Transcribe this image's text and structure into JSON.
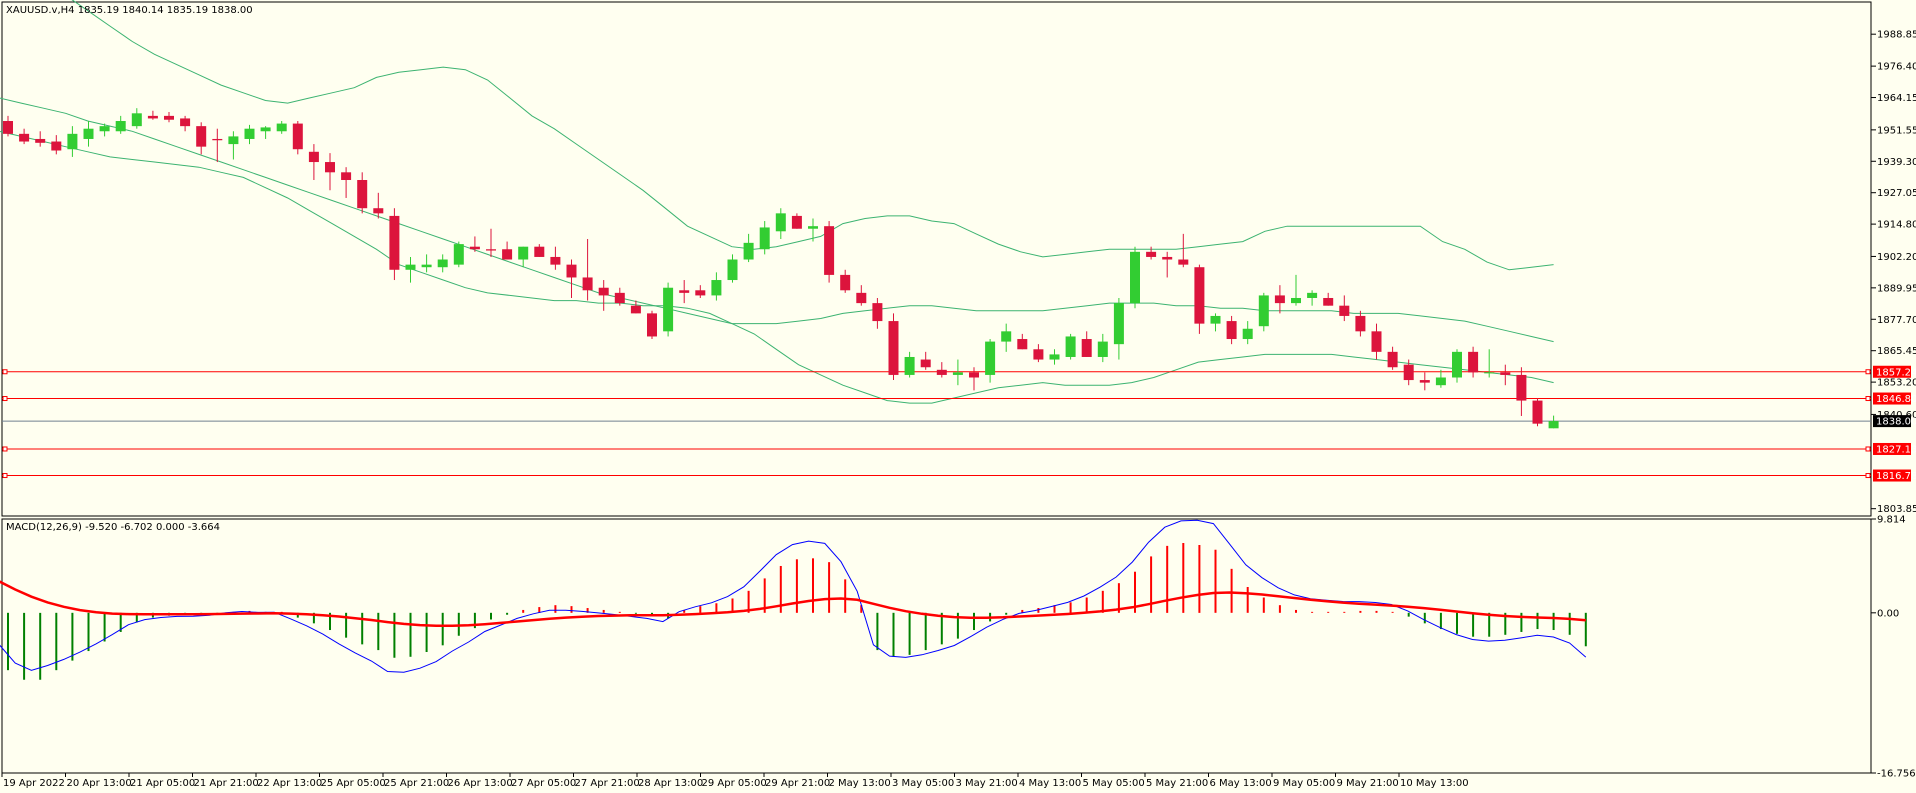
{
  "symbol_label": "XAUUSD.v,H4  1835.19 1840.14 1835.19 1838.00",
  "macd_label": "MACD(12,26,9) -9.520 -6.702 0.000 -3.664",
  "colors": {
    "background": "#fffff0",
    "bull": "#32cd32",
    "bear": "#dc143c",
    "band": "#3cb371",
    "level_line": "#ff0000",
    "current_line": "#708090",
    "macd_line": "#0000ff",
    "signal_line": "#ff0000",
    "hist_pos": "#ff0000",
    "hist_neg": "#008000"
  },
  "chart_data": [
    {
      "type": "candlestick",
      "title": "XAUUSD.v,H4",
      "ylim": [
        1801.0,
        2001.4
      ],
      "y_ticks": [
        1988.85,
        1976.4,
        1964.15,
        1951.55,
        1939.3,
        1927.05,
        1914.8,
        1902.2,
        1889.95,
        1877.7,
        1865.45,
        1853.2,
        1840.6,
        1803.85
      ],
      "x_ticks": [
        "19 Apr 2022",
        "20 Apr 13:00",
        "21 Apr 05:00",
        "21 Apr 21:00",
        "22 Apr 13:00",
        "25 Apr 05:00",
        "25 Apr 21:00",
        "26 Apr 13:00",
        "27 Apr 05:00",
        "27 Apr 21:00",
        "28 Apr 13:00",
        "29 Apr 05:00",
        "29 Apr 21:00",
        "2 May 13:00",
        "3 May 05:00",
        "3 May 21:00",
        "4 May 13:00",
        "5 May 05:00",
        "5 May 21:00",
        "6 May 13:00",
        "9 May 05:00",
        "9 May 21:00",
        "10 May 13:00"
      ],
      "candles": [
        [
          1955.0,
          1957.0,
          1949.0,
          1950.0
        ],
        [
          1950.0,
          1952.0,
          1946.0,
          1947.0
        ],
        [
          1948.0,
          1951.0,
          1945.0,
          1946.5
        ],
        [
          1947.0,
          1949.5,
          1942.0,
          1943.5
        ],
        [
          1944.0,
          1953.0,
          1941.0,
          1950.0
        ],
        [
          1948.0,
          1955.0,
          1945.0,
          1952.0
        ],
        [
          1951.0,
          1954.0,
          1949.0,
          1953.0
        ],
        [
          1951.0,
          1957.0,
          1950.0,
          1955.0
        ],
        [
          1953.0,
          1960.0,
          1952.0,
          1958.0
        ],
        [
          1957.0,
          1959.0,
          1955.5,
          1956.0
        ],
        [
          1957.0,
          1958.5,
          1954.5,
          1955.5
        ],
        [
          1956.0,
          1957.0,
          1951.0,
          1953.0
        ],
        [
          1953.0,
          1954.5,
          1942.0,
          1945.0
        ],
        [
          1948.0,
          1952.0,
          1939.0,
          1947.5
        ],
        [
          1946.0,
          1951.0,
          1940.0,
          1949.0
        ],
        [
          1948.0,
          1953.5,
          1946.0,
          1952.0
        ],
        [
          1951.0,
          1953.0,
          1948.0,
          1952.5
        ],
        [
          1951.0,
          1955.0,
          1950.0,
          1954.0
        ],
        [
          1954.0,
          1955.0,
          1942.0,
          1944.0
        ],
        [
          1943.0,
          1946.0,
          1932.0,
          1939.0
        ],
        [
          1939.0,
          1942.5,
          1928.0,
          1935.0
        ],
        [
          1935.0,
          1937.0,
          1925.0,
          1932.0
        ],
        [
          1932.0,
          1935.0,
          1919.0,
          1921.0
        ],
        [
          1921.0,
          1927.0,
          1917.0,
          1919.0
        ],
        [
          1918.0,
          1921.0,
          1893.0,
          1897.0
        ],
        [
          1897.0,
          1902.0,
          1892.0,
          1899.0
        ],
        [
          1898.0,
          1903.0,
          1896.0,
          1899.0
        ],
        [
          1898.0,
          1903.0,
          1896.0,
          1901.0
        ],
        [
          1899.0,
          1908.0,
          1898.0,
          1907.0
        ],
        [
          1906.0,
          1910.0,
          1904.0,
          1905.0
        ],
        [
          1905.0,
          1913.0,
          1902.0,
          1904.5
        ],
        [
          1905.0,
          1908.0,
          1901.0,
          1901.0
        ],
        [
          1901.0,
          1906.0,
          1898.0,
          1906.0
        ],
        [
          1906.0,
          1907.0,
          1902.0,
          1902.0
        ],
        [
          1902.0,
          1906.0,
          1897.0,
          1899.0
        ],
        [
          1899.0,
          1901.0,
          1886.0,
          1894.0
        ],
        [
          1894.0,
          1909.0,
          1885.0,
          1889.0
        ],
        [
          1890.0,
          1893.0,
          1881.0,
          1887.0
        ],
        [
          1888.0,
          1890.0,
          1883.0,
          1884.0
        ],
        [
          1883.0,
          1885.0,
          1880.0,
          1880.0
        ],
        [
          1880.0,
          1881.0,
          1870.0,
          1871.0
        ],
        [
          1873.0,
          1892.0,
          1871.0,
          1890.0
        ],
        [
          1889.0,
          1893.0,
          1884.0,
          1888.0
        ],
        [
          1889.0,
          1891.0,
          1886.0,
          1887.0
        ],
        [
          1887.0,
          1896.0,
          1885.0,
          1893.0
        ],
        [
          1893.0,
          1903.0,
          1892.0,
          1901.0
        ],
        [
          1901.0,
          1911.0,
          1900.0,
          1907.5
        ],
        [
          1905.0,
          1916.0,
          1903.0,
          1913.5
        ],
        [
          1912.0,
          1921.0,
          1909.0,
          1919.0
        ],
        [
          1918.0,
          1919.0,
          1913.0,
          1913.0
        ],
        [
          1913.0,
          1917.0,
          1908.0,
          1914.0
        ],
        [
          1914.0,
          1916.0,
          1892.0,
          1895.0
        ],
        [
          1895.0,
          1897.0,
          1888.0,
          1889.0
        ],
        [
          1888.0,
          1891.0,
          1883.0,
          1884.0
        ],
        [
          1884.0,
          1886.0,
          1874.0,
          1877.0
        ],
        [
          1877.0,
          1880.0,
          1854.0,
          1856.0
        ],
        [
          1856.0,
          1865.0,
          1855.0,
          1863.0
        ],
        [
          1862.0,
          1865.0,
          1858.0,
          1859.0
        ],
        [
          1858.0,
          1861.0,
          1855.0,
          1856.0
        ],
        [
          1856.0,
          1862.0,
          1852.0,
          1857.0
        ],
        [
          1857.0,
          1859.0,
          1850.0,
          1855.0
        ],
        [
          1856.0,
          1870.0,
          1853.0,
          1869.0
        ],
        [
          1869.0,
          1876.0,
          1865.0,
          1873.0
        ],
        [
          1870.0,
          1872.0,
          1866.0,
          1866.0
        ],
        [
          1866.0,
          1868.0,
          1861.0,
          1862.0
        ],
        [
          1862.0,
          1866.0,
          1860.0,
          1864.0
        ],
        [
          1863.0,
          1872.0,
          1862.0,
          1871.0
        ],
        [
          1870.0,
          1873.0,
          1863.0,
          1863.0
        ],
        [
          1863.0,
          1872.0,
          1861.0,
          1869.0
        ],
        [
          1868.0,
          1886.0,
          1862.0,
          1884.0
        ],
        [
          1884.0,
          1906.0,
          1882.0,
          1904.0
        ],
        [
          1904.0,
          1906.0,
          1901.0,
          1902.0
        ],
        [
          1902.0,
          1904.0,
          1894.0,
          1901.0
        ],
        [
          1901.0,
          1911.0,
          1898.0,
          1899.0
        ],
        [
          1898.0,
          1899.0,
          1872.0,
          1876.0
        ],
        [
          1876.0,
          1880.0,
          1873.0,
          1879.0
        ],
        [
          1877.0,
          1879.0,
          1868.0,
          1870.0
        ],
        [
          1870.0,
          1877.0,
          1868.0,
          1874.0
        ],
        [
          1875.0,
          1888.0,
          1873.0,
          1887.0
        ],
        [
          1887.0,
          1891.0,
          1880.0,
          1884.0
        ],
        [
          1884.0,
          1895.0,
          1883.0,
          1886.0
        ],
        [
          1886.0,
          1889.0,
          1883.0,
          1888.0
        ],
        [
          1886.0,
          1888.0,
          1883.0,
          1883.0
        ],
        [
          1883.0,
          1887.0,
          1877.0,
          1879.0
        ],
        [
          1879.0,
          1881.0,
          1871.0,
          1873.0
        ],
        [
          1873.0,
          1876.0,
          1862.0,
          1865.0
        ],
        [
          1865.0,
          1867.0,
          1858.0,
          1859.0
        ],
        [
          1860.0,
          1862.0,
          1852.0,
          1854.0
        ],
        [
          1854.0,
          1857.0,
          1850.0,
          1853.0
        ],
        [
          1852.0,
          1858.0,
          1851.0,
          1855.0
        ],
        [
          1855.0,
          1866.0,
          1853.0,
          1865.0
        ],
        [
          1865.0,
          1867.0,
          1855.0,
          1857.0
        ],
        [
          1857.0,
          1866.0,
          1855.0,
          1857.0
        ],
        [
          1857.0,
          1860.0,
          1852.0,
          1856.0
        ],
        [
          1856.0,
          1859.0,
          1840.0,
          1846.0
        ],
        [
          1846.0,
          1847.0,
          1836.0,
          1837.0
        ],
        [
          1835.19,
          1840.14,
          1835.19,
          1838.0
        ]
      ],
      "bands": {
        "upper": [
          2020,
          2016,
          2010,
          2004,
          1998,
          1992,
          1986,
          1981,
          1977,
          1973,
          1969,
          1966,
          1963,
          1962,
          1964,
          1966,
          1968,
          1972,
          1974,
          1975,
          1976,
          1975,
          1971,
          1964,
          1957,
          1952,
          1946,
          1940,
          1934,
          1928,
          1921,
          1914,
          1910,
          1906,
          1905,
          1906,
          1908,
          1910,
          1915,
          1917,
          1918,
          1918,
          1916,
          1915,
          1911,
          1907,
          1904,
          1902,
          1903,
          1904,
          1905,
          1905,
          1905,
          1905,
          1906,
          1907,
          1908,
          1912,
          1914,
          1914,
          1914,
          1914,
          1914,
          1914,
          1914,
          1908,
          1905,
          1900,
          1897,
          1898,
          1899
        ],
        "middle": [
          1964,
          1962,
          1960,
          1958,
          1955,
          1953,
          1951,
          1948,
          1945,
          1942,
          1939,
          1936,
          1933,
          1930,
          1927,
          1924,
          1921,
          1918,
          1915,
          1912,
          1909,
          1906,
          1903,
          1900,
          1897,
          1894,
          1891,
          1888,
          1886,
          1884,
          1882,
          1880,
          1878,
          1876,
          1876,
          1876,
          1877,
          1878,
          1880,
          1881,
          1882,
          1883,
          1883,
          1882,
          1881,
          1881,
          1881,
          1881,
          1882,
          1883,
          1884,
          1884,
          1884,
          1883,
          1883,
          1882,
          1882,
          1881,
          1881,
          1881,
          1881,
          1880,
          1880,
          1880,
          1879,
          1878,
          1877,
          1875,
          1873,
          1871,
          1869
        ],
        "lower": [
          1951,
          1949,
          1947,
          1945,
          1943,
          1941,
          1940,
          1939,
          1938,
          1937,
          1935,
          1933,
          1929,
          1925,
          1920,
          1915,
          1910,
          1905,
          1899,
          1896,
          1893,
          1890,
          1888,
          1887,
          1886,
          1885,
          1885,
          1884,
          1884,
          1883,
          1883,
          1882,
          1880,
          1876,
          1872,
          1866,
          1860,
          1856,
          1852,
          1849,
          1846,
          1845,
          1845,
          1847,
          1849,
          1851,
          1852,
          1853,
          1852,
          1852,
          1852,
          1853,
          1855,
          1858,
          1861,
          1862,
          1863,
          1864,
          1864,
          1864,
          1864,
          1863,
          1862,
          1861,
          1860,
          1859,
          1858,
          1857,
          1856,
          1855,
          1853
        ]
      },
      "horizontal_levels": [
        1857.24,
        1846.8,
        1827.13,
        1816.78
      ],
      "current_price": 1838.0,
      "price_labels": [
        "1857.24",
        "1846.80",
        "1838.00",
        "1827.13",
        "1816.78"
      ]
    },
    {
      "type": "macd",
      "title": "MACD(12,26,9)",
      "ylim": [
        -16.756,
        9.814
      ],
      "y_ticks": [
        "9.814",
        "0.00",
        "-16.756"
      ],
      "histogram": [
        -6,
        -7,
        -7,
        -6,
        -5,
        -4,
        -3,
        -2,
        -1,
        -0.5,
        -0.3,
        -0.2,
        -0.2,
        -0.1,
        0.1,
        0.2,
        0.1,
        0.1,
        -0.5,
        -1.1,
        -1.8,
        -2.6,
        -3.3,
        -3.9,
        -4.7,
        -4.6,
        -4.1,
        -3.4,
        -2.4,
        -1.6,
        -0.7,
        -0.2,
        0.3,
        0.6,
        0.8,
        0.7,
        0.5,
        0.3,
        0.1,
        -0.1,
        -0.3,
        -0.6,
        0.3,
        0.7,
        1.0,
        1.5,
        2.3,
        3.6,
        4.9,
        5.6,
        5.7,
        5.3,
        3.5,
        0.8,
        -3.9,
        -4.6,
        -4.4,
        -3.9,
        -3.3,
        -2.7,
        -1.8,
        -0.9,
        -0.2,
        0.3,
        0.5,
        0.8,
        1.1,
        1.6,
        2.3,
        3.1,
        4.3,
        5.9,
        7.0,
        7.3,
        7.1,
        6.6,
        4.6,
        2.7,
        1.6,
        0.8,
        0.3,
        0.1,
        0.1,
        0.1,
        0.2,
        0.2,
        0.1,
        -0.4,
        -1.1,
        -1.7,
        -2.2,
        -2.5,
        -2.5,
        -2.3,
        -2.0,
        -1.7,
        -1.8,
        -2.3,
        -3.5
      ]
    }
  ]
}
